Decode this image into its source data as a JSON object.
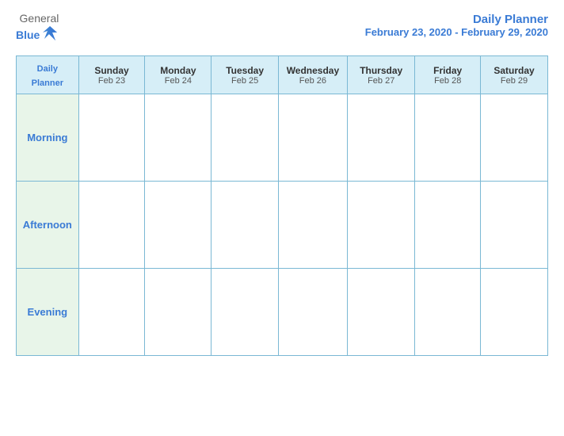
{
  "logo": {
    "general": "General",
    "blue": "Blue"
  },
  "header": {
    "title": "Daily Planner",
    "subtitle": "February 23, 2020 - February 29, 2020"
  },
  "table": {
    "corner_label_line1": "Daily",
    "corner_label_line2": "Planner",
    "columns": [
      {
        "day": "Sunday",
        "date": "Feb 23"
      },
      {
        "day": "Monday",
        "date": "Feb 24"
      },
      {
        "day": "Tuesday",
        "date": "Feb 25"
      },
      {
        "day": "Wednesday",
        "date": "Feb 26"
      },
      {
        "day": "Thursday",
        "date": "Feb 27"
      },
      {
        "day": "Friday",
        "date": "Feb 28"
      },
      {
        "day": "Saturday",
        "date": "Feb 29"
      }
    ],
    "rows": [
      "Morning",
      "Afternoon",
      "Evening"
    ]
  }
}
